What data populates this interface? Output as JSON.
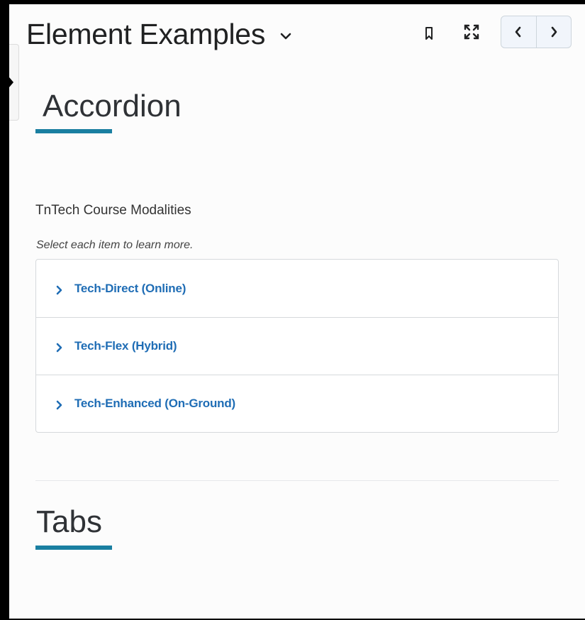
{
  "header": {
    "title": "Element Examples",
    "icons": {
      "dropdown": "chevron-down-icon",
      "bookmark": "bookmark-icon",
      "fullscreen": "fullscreen-icon",
      "previous": "chevron-left-icon",
      "next": "chevron-right-icon"
    }
  },
  "sections": {
    "accordion": {
      "heading": "Accordion",
      "subheading": "TnTech Course Modalities",
      "instruction": "Select each item to learn more.",
      "items": [
        {
          "label": "Tech-Direct (Online)",
          "icon": "chevron-right-icon"
        },
        {
          "label": "Tech-Flex (Hybrid)",
          "icon": "chevron-right-icon"
        },
        {
          "label": "Tech-Enhanced (On-Ground)",
          "icon": "chevron-right-icon"
        }
      ]
    },
    "tabs": {
      "heading": "Tabs"
    }
  },
  "colors": {
    "accent_underline": "#1a7fa1",
    "link_blue": "#1f6db5",
    "heading_text": "#2f3236"
  }
}
